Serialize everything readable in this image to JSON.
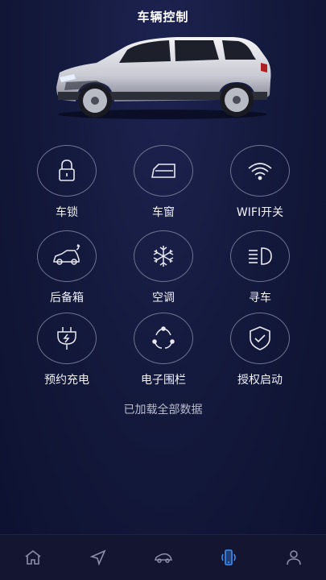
{
  "header": {
    "title": "车辆控制"
  },
  "controls": [
    {
      "label": "车锁",
      "icon": "lock-icon"
    },
    {
      "label": "车窗",
      "icon": "car-window-icon"
    },
    {
      "label": "WIFI开关",
      "icon": "wifi-icon"
    },
    {
      "label": "后备箱",
      "icon": "trunk-icon"
    },
    {
      "label": "空调",
      "icon": "snowflake-icon"
    },
    {
      "label": "寻车",
      "icon": "headlight-icon"
    },
    {
      "label": "预约充电",
      "icon": "charging-plug-icon"
    },
    {
      "label": "电子围栏",
      "icon": "geofence-icon"
    },
    {
      "label": "授权启动",
      "icon": "shield-check-icon"
    }
  ],
  "status_text": "已加载全部数据",
  "tabbar": {
    "items": [
      {
        "icon": "home-icon",
        "active": false
      },
      {
        "icon": "navigation-arrow-icon",
        "active": false
      },
      {
        "icon": "car-icon",
        "active": false
      },
      {
        "icon": "phone-vibrate-icon",
        "active": true
      },
      {
        "icon": "user-icon",
        "active": false
      }
    ],
    "active_color": "#3a8ef6",
    "inactive_color": "#8a8ea6"
  }
}
